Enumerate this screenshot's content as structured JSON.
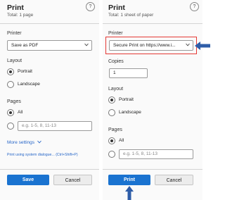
{
  "left": {
    "title": "Print",
    "subtitle": "Total: 1 page",
    "help": "?",
    "printer_label": "Printer",
    "printer_value": "Save as PDF",
    "layout_label": "Layout",
    "portrait": "Portrait",
    "landscape": "Landscape",
    "pages_label": "Pages",
    "all": "All",
    "pages_placeholder": "e.g. 1-5, 8, 11-13",
    "more_settings": "More settings",
    "system_dialog": "Print using system dialogue... (Ctrl+Shift+P)",
    "save_button": "Save",
    "cancel_button": "Cancel"
  },
  "right": {
    "title": "Print",
    "subtitle": "Total: 1 sheet of paper",
    "help": "?",
    "printer_label": "Printer",
    "printer_value": "Secure Print on https://www.i...",
    "copies_label": "Copies",
    "copies_value": "1",
    "layout_label": "Layout",
    "portrait": "Portrait",
    "landscape": "Landscape",
    "pages_label": "Pages",
    "all": "All",
    "pages_placeholder": "e.g. 1-5, 8, 11-13",
    "print_button": "Print",
    "cancel_button": "Cancel"
  },
  "colors": {
    "primary": "#1a73d0",
    "highlight": "#e53935",
    "arrow": "#2e5da8"
  }
}
